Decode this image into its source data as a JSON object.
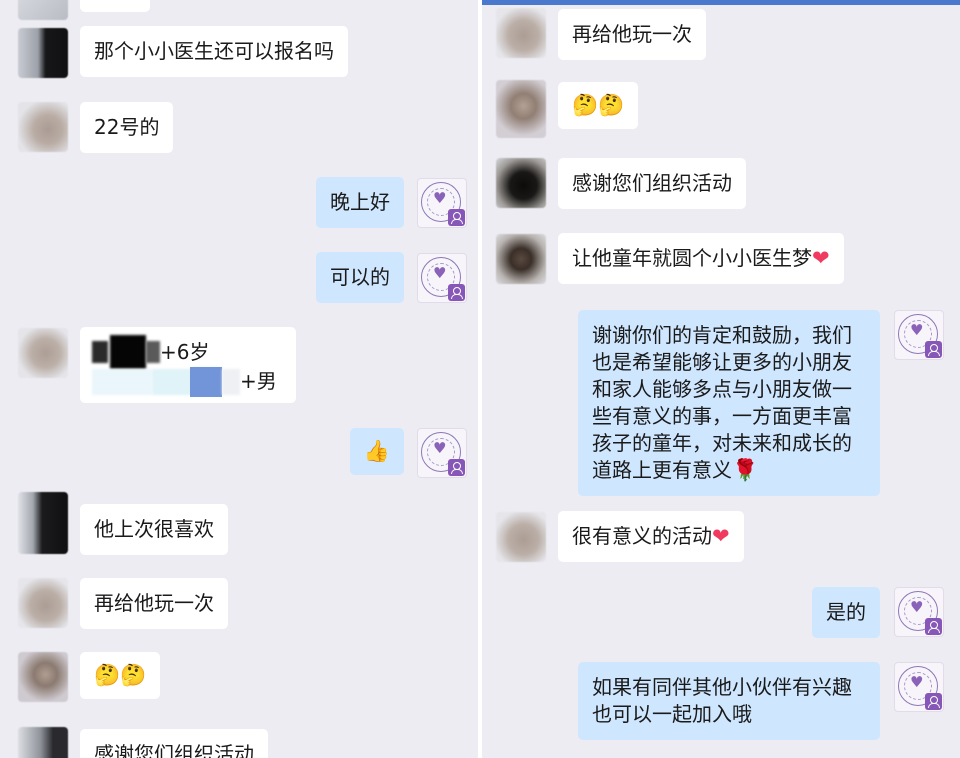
{
  "colors": {
    "background": "#ececf2",
    "incoming_bubble": "#ffffff",
    "outgoing_bubble": "#cfe6ff",
    "accent": "#4a78cc",
    "logo_purple": "#8757b8"
  },
  "icons": {
    "thinking_face": "🤔",
    "thumbs_up": "👍",
    "heart": "❤",
    "rose": "🌹",
    "org_logo": "heart-in-circle-logo-icon"
  },
  "left": {
    "messages": [
      {
        "side": "in",
        "text": "那个小小医生还可以报名吗"
      },
      {
        "side": "in",
        "text": "22号的"
      },
      {
        "side": "out",
        "text": "晚上好"
      },
      {
        "side": "out",
        "text": "可以的"
      },
      {
        "side": "in",
        "line1_visible": "+6岁",
        "line2_visible": "+男"
      },
      {
        "side": "out",
        "emoji": "👍"
      },
      {
        "side": "in",
        "text": "他上次很喜欢"
      },
      {
        "side": "in",
        "text": "再给他玩一次"
      },
      {
        "side": "in",
        "emoji": "🤔🤔"
      },
      {
        "side": "in",
        "text": "感谢您们组织活动"
      }
    ]
  },
  "right": {
    "messages": [
      {
        "side": "in",
        "text": "再给他玩一次"
      },
      {
        "side": "in",
        "emoji": "🤔🤔"
      },
      {
        "side": "in",
        "text": "感谢您们组织活动"
      },
      {
        "side": "in",
        "text": "让他童年就圆个小小医生梦",
        "emoji_after": "❤"
      },
      {
        "side": "out",
        "lines": [
          "谢谢你们的肯定和鼓励，我们",
          "也是希望能够让更多的小朋友",
          "和家人能够多点与小朋友做一",
          "些有意义的事，一方面更丰富",
          "孩子的童年，对未来和成长的",
          "道路上更有意义"
        ],
        "emoji_after": "🌹"
      },
      {
        "side": "in",
        "text": "很有意义的活动",
        "emoji_after": "❤"
      },
      {
        "side": "out",
        "text": "是的"
      },
      {
        "side": "out",
        "lines": [
          "如果有同伴其他小伙伴有兴趣",
          "也可以一起加入哦"
        ]
      }
    ]
  }
}
